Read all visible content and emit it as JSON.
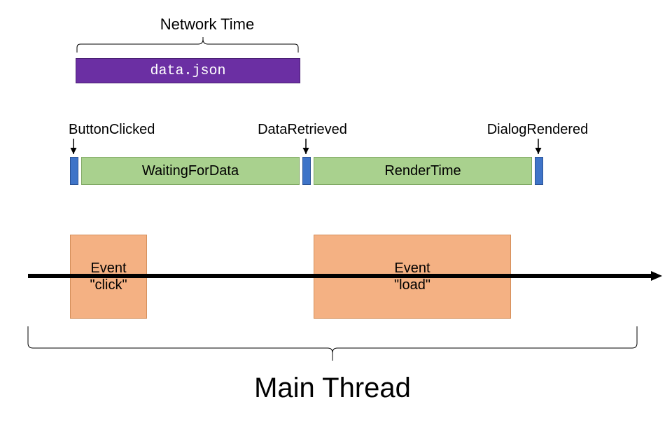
{
  "title_top": "Network Time",
  "network_bar_label": "data.json",
  "markers": {
    "button_clicked": "ButtonClicked",
    "data_retrieved": "DataRetrieved",
    "dialog_rendered": "DialogRendered"
  },
  "measures": {
    "waiting_for_data": "WaitingForData",
    "render_time": "RenderTime"
  },
  "events": {
    "click": {
      "line1": "Event",
      "line2": "\"click\""
    },
    "load": {
      "line1": "Event",
      "line2": "\"load\""
    }
  },
  "main_label": "Main Thread",
  "colors": {
    "network_bar": "#6b2fa3",
    "marker": "#3f74c8",
    "measure": "#a9d18e",
    "event": "#f4b183"
  }
}
